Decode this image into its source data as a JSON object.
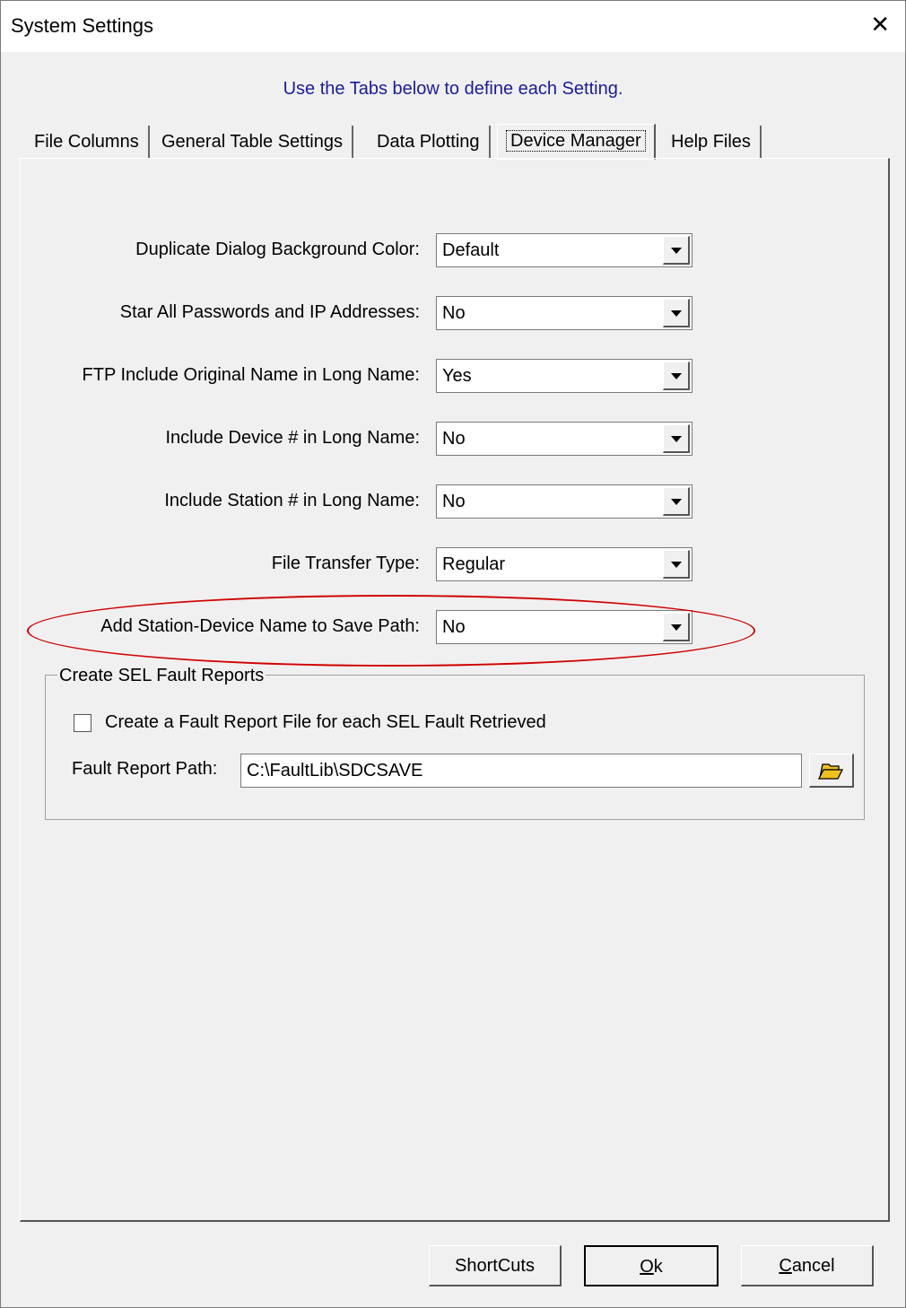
{
  "window": {
    "title": "System Settings"
  },
  "instructions": "Use the Tabs below to define each Setting.",
  "tabs": [
    {
      "label": "File Columns"
    },
    {
      "label": "General Table Settings"
    },
    {
      "label": "Data Plotting"
    },
    {
      "label": "Device Manager",
      "active": true
    },
    {
      "label": "Help Files"
    }
  ],
  "settings": [
    {
      "label": "Duplicate Dialog Background Color:",
      "value": "Default"
    },
    {
      "label": "Star All Passwords and IP Addresses:",
      "value": "No"
    },
    {
      "label": "FTP Include Original Name in Long Name:",
      "value": "Yes"
    },
    {
      "label": "Include Device # in Long Name:",
      "value": "No"
    },
    {
      "label": "Include Station # in Long Name:",
      "value": "No"
    },
    {
      "label": "File Transfer Type:",
      "value": "Regular"
    },
    {
      "label": "Add Station-Device Name to Save Path:",
      "value": "No"
    }
  ],
  "fault_reports": {
    "group_label": "Create SEL Fault Reports",
    "checkbox_label": "Create a Fault Report File for each SEL Fault Retrieved",
    "checked": false,
    "path_label": "Fault Report Path:",
    "path_value": "C:\\FaultLib\\SDCSAVE"
  },
  "buttons": {
    "shortcuts": "ShortCuts",
    "ok_mnemonic": "O",
    "ok_rest": "k",
    "cancel_mnemonic": "C",
    "cancel_rest": "ancel"
  },
  "colors": {
    "instruction_text": "#1b1b9a",
    "highlight_ellipse": "#d00000",
    "folder_icon": "#f0c020"
  },
  "icons": {
    "close": "close-icon",
    "dropdown": "chevron-down-icon",
    "folder": "folder-open-icon"
  }
}
